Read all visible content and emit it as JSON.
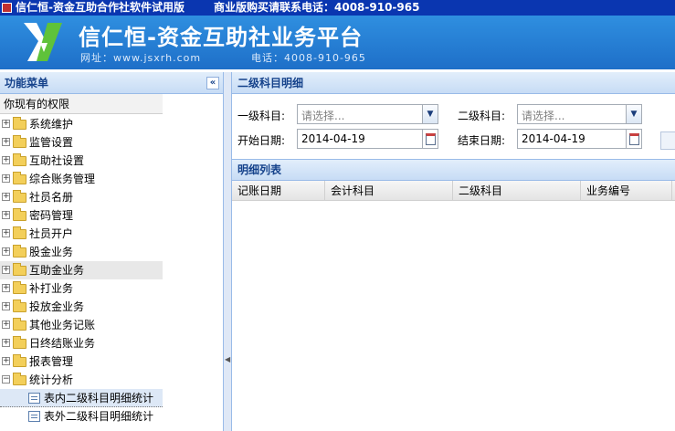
{
  "window": {
    "title": "信仁恒-资金互助合作社软件试用版",
    "notice": "商业版购买请联系电话：4008-910-965"
  },
  "banner": {
    "brand": "信仁恒-资金互助社业务平台",
    "website": "网址：www.jsxrh.com",
    "phone": "电话：4008-910-965"
  },
  "sidebar": {
    "title": "功能菜单",
    "permissions_label": "你现有的权限",
    "items": [
      {
        "label": "系统维护"
      },
      {
        "label": "监管设置"
      },
      {
        "label": "互助社设置"
      },
      {
        "label": "综合账务管理"
      },
      {
        "label": "社员名册"
      },
      {
        "label": "密码管理"
      },
      {
        "label": "社员开户"
      },
      {
        "label": "股金业务"
      },
      {
        "label": "互助金业务"
      },
      {
        "label": "补打业务"
      },
      {
        "label": "投放金业务"
      },
      {
        "label": "其他业务记账"
      },
      {
        "label": "日终结账业务"
      },
      {
        "label": "报表管理"
      },
      {
        "label": "统计分析"
      }
    ],
    "subitems": [
      {
        "label": "表内二级科目明细统计"
      },
      {
        "label": "表外二级科目明细统计"
      }
    ]
  },
  "main": {
    "title": "二级科目明细",
    "form": {
      "level1_label": "一级科目:",
      "level1_placeholder": "请选择...",
      "level2_label": "二级科目:",
      "level2_placeholder": "请选择...",
      "start_label": "开始日期:",
      "start_value": "2014-04-19",
      "end_label": "结束日期:",
      "end_value": "2014-04-19"
    },
    "list_title": "明细列表",
    "columns": [
      "记账日期",
      "会计科目",
      "二级科目",
      "业务编号"
    ]
  }
}
